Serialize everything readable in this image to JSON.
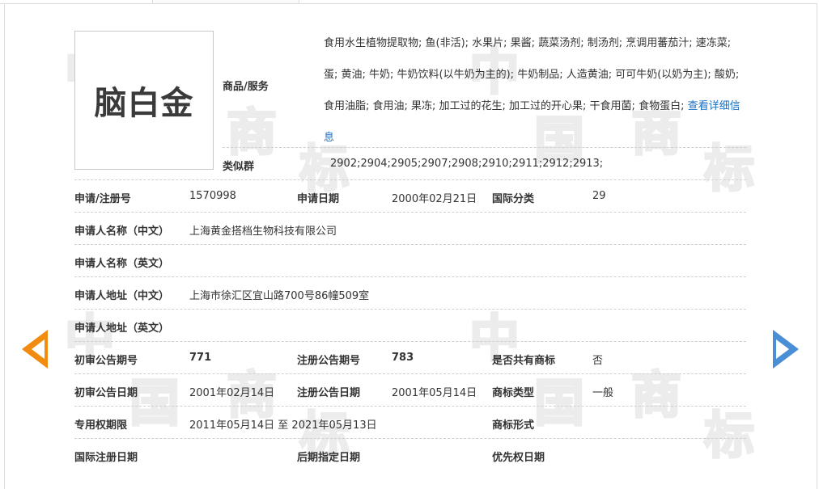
{
  "logo": {
    "text": "脑白金"
  },
  "goods": {
    "label": "商品/服务",
    "text": "食用水生植物提取物; 鱼(非活); 水果片; 果酱; 蔬菜汤剂; 制汤剂; 烹调用蕃茄汁; 速冻菜; 蛋; 黄油; 牛奶; 牛奶饮料(以牛奶为主的); 牛奶制品; 人造黄油; 可可牛奶(以奶为主); 酸奶; 食用油脂; 食用油; 果冻; 加工过的花生; 加工过的开心果; 干食用菌; 食物蛋白; ",
    "link": "查看详细信息"
  },
  "similar_group": {
    "label": "类似群",
    "value": "2902;2904;2905;2907;2908;2910;2911;2912;2913;"
  },
  "rows": {
    "reg_no": {
      "label": "申请/注册号",
      "value": "1570998"
    },
    "app_date": {
      "label": "申请日期",
      "value": "2000年02月21日"
    },
    "intl_class": {
      "label": "国际分类",
      "value": "29"
    },
    "applicant_cn": {
      "label": "申请人名称（中文）",
      "value": "上海黄金搭档生物科技有限公司"
    },
    "applicant_en": {
      "label": "申请人名称（英文）",
      "value": ""
    },
    "address_cn": {
      "label": "申请人地址（中文）",
      "value": "上海市徐汇区宜山路700号86幢509室"
    },
    "address_en": {
      "label": "申请人地址（英文）",
      "value": ""
    },
    "prelim_issue": {
      "label": "初审公告期号",
      "value": "771"
    },
    "reg_issue": {
      "label": "注册公告期号",
      "value": "783"
    },
    "shared": {
      "label": "是否共有商标",
      "value": "否"
    },
    "prelim_date": {
      "label": "初审公告日期",
      "value": "2001年02月14日"
    },
    "reg_date": {
      "label": "注册公告日期",
      "value": "2001年05月14日"
    },
    "tm_type": {
      "label": "商标类型",
      "value": "一般"
    },
    "exclusive": {
      "label": "专用权期限",
      "value": "2011年05月14日 至 2021年05月13日"
    },
    "tm_form": {
      "label": "商标形式",
      "value": ""
    },
    "intl_reg_date": {
      "label": "国际注册日期",
      "value": ""
    },
    "later_date": {
      "label": "后期指定日期",
      "value": ""
    },
    "priority_date": {
      "label": "优先权日期",
      "value": ""
    }
  },
  "watermark": {
    "chars": [
      "中",
      "国",
      "商",
      "标"
    ]
  },
  "colors": {
    "prev_arrow": "#f28c10",
    "next_arrow": "#4a8fd6",
    "link": "#1a6fc4"
  },
  "icons": {
    "prev": "arrow-left-icon",
    "next": "arrow-right-icon"
  }
}
